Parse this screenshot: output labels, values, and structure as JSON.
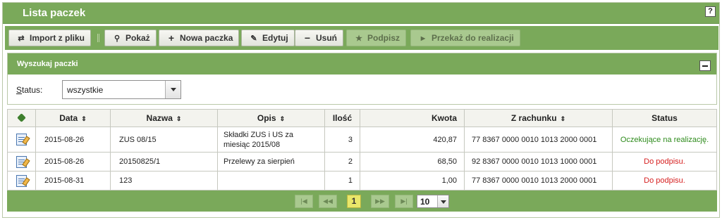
{
  "header": {
    "title": "Lista paczek",
    "help_label": "?"
  },
  "toolbar": {
    "import_label": "Import z pliku",
    "show_label": "Pokaż",
    "new_label": "Nowa paczka",
    "edit_label": "Edytuj",
    "delete_label": "Usuń",
    "sign_label": "Podpisz",
    "realize_label": "Przekaż do realizacji"
  },
  "search_panel": {
    "title": "Wyszukaj paczki",
    "status_label_first": "S",
    "status_label_rest": "tatus:",
    "status_value": "wszystkie"
  },
  "table": {
    "columns": {
      "data": "Data",
      "nazwa": "Nazwa",
      "opis": "Opis",
      "ilosc": "Ilość",
      "kwota": "Kwota",
      "rachunek": "Z rachunku",
      "status": "Status"
    },
    "rows": [
      {
        "data": "2015-08-26",
        "nazwa": "ZUS 08/15",
        "opis_line1": "Składki ZUS i US za",
        "opis_line2": "miesiąc 2015/08",
        "ilosc": "3",
        "kwota": "420,87",
        "rachunek": "77 8367 0000 0010 1013 2000 0001",
        "status": "Oczekujące na realizację."
      },
      {
        "data": "2015-08-26",
        "nazwa": "20150825/1",
        "opis": "Przelewy za sierpień",
        "ilosc": "2",
        "kwota": "68,50",
        "rachunek": "92 8367 0000 0010 1013 1000 0001",
        "status": "Do podpisu."
      },
      {
        "data": "2015-08-31",
        "nazwa": "123",
        "opis": "",
        "ilosc": "1",
        "kwota": "1,00",
        "rachunek": "77 8367 0000 0010 1013 2000 0001",
        "status": "Do podpisu."
      }
    ]
  },
  "pager": {
    "current_page": "1",
    "page_size": "10"
  },
  "colors": {
    "accent": "#7aa95a",
    "status_pending": "#2e8b1c",
    "status_sign": "#d61f1f"
  }
}
